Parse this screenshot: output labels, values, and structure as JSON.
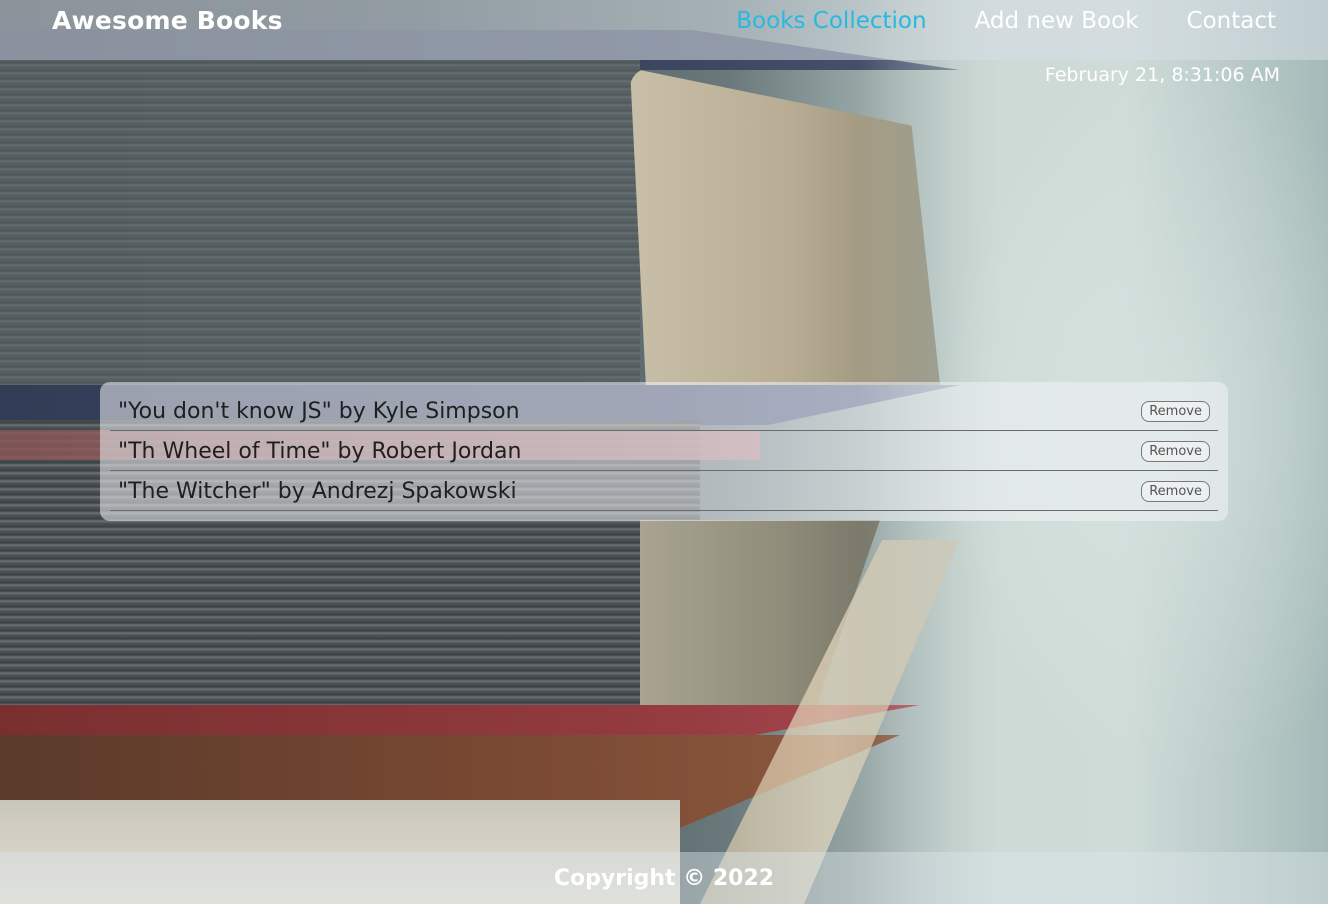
{
  "header": {
    "brand": "Awesome Books",
    "nav": [
      {
        "label": "Books Collection",
        "active": true
      },
      {
        "label": "Add new Book",
        "active": false
      },
      {
        "label": "Contact",
        "active": false
      }
    ]
  },
  "datetime": "February 21, 8:31:06 AM",
  "books": [
    {
      "title": "\"You don't know JS\" by Kyle Simpson",
      "remove_label": "Remove"
    },
    {
      "title": "\"Th Wheel of Time\" by Robert Jordan",
      "remove_label": "Remove"
    },
    {
      "title": "\"The Witcher\" by Andrezj Spakowski",
      "remove_label": "Remove"
    }
  ],
  "footer": {
    "copyright": "Copyright © 2022"
  },
  "colors": {
    "active_nav": "#27b9e0",
    "header_text": "#ffffff"
  }
}
